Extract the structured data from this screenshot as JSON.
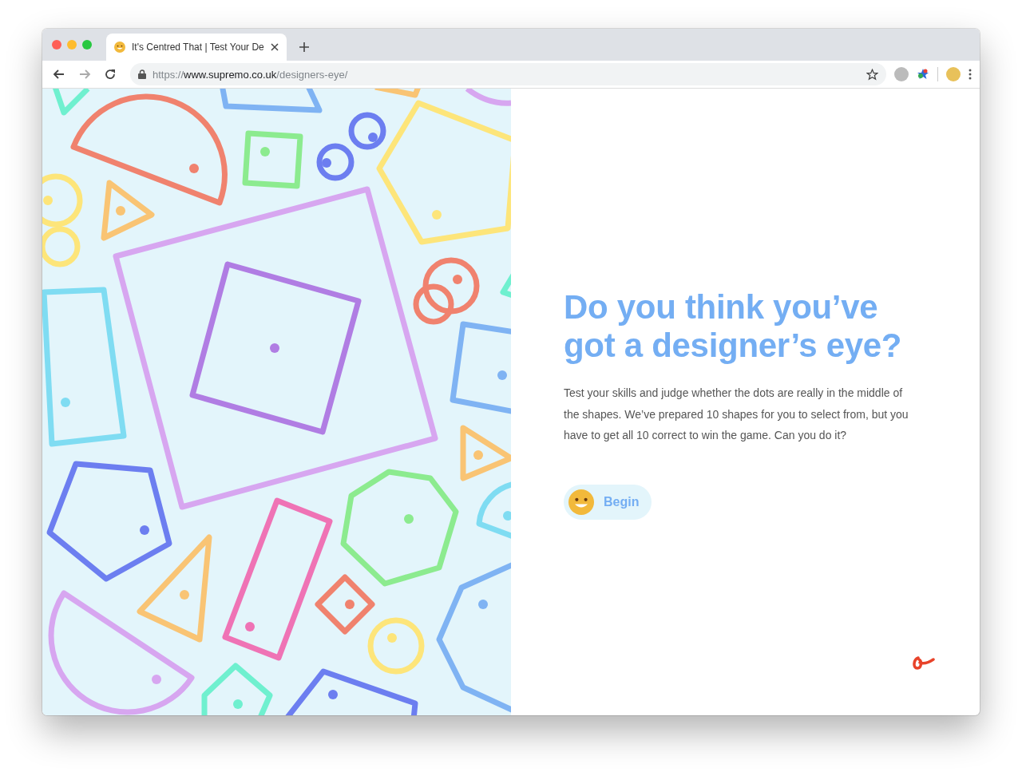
{
  "browser": {
    "tab": {
      "title": "It's Centred That | Test Your De",
      "selected": true
    },
    "url": {
      "scheme": "https://",
      "host": "www.supremo.co.uk",
      "path": "/designers-eye/"
    }
  },
  "hero": {
    "heading": "Do you think you’ve got a designer’s eye?",
    "body": "Test your skills and judge whether the dots are really in the middle of the shapes. We’ve prepared 10 shapes for you to select from, but you have to get all 10 correct to win the game. Can you do it?",
    "button": "Begin"
  }
}
